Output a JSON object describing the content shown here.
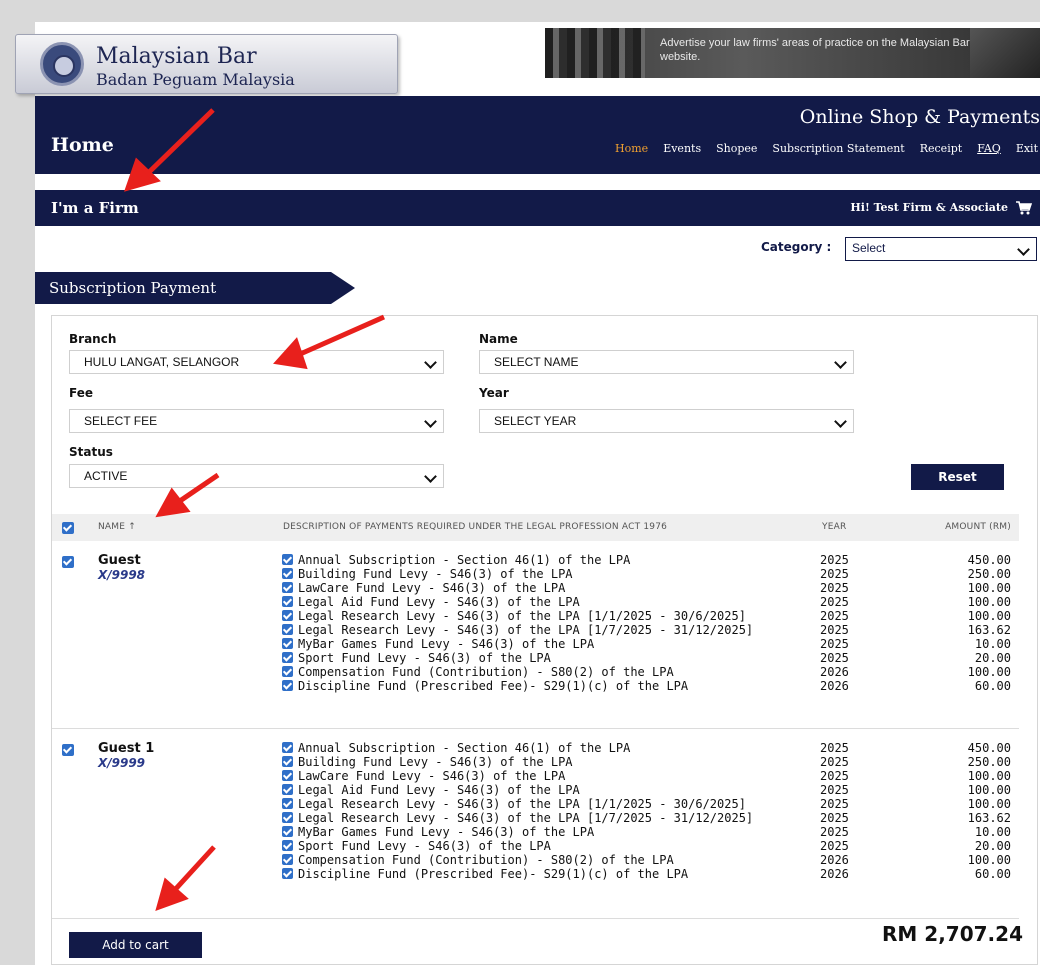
{
  "header": {
    "logo_title": "Malaysian Bar",
    "logo_subtitle": "Badan Peguam Malaysia",
    "ad_text": "Advertise your law firms' areas of practice on the Malaysian Bar website.",
    "shop_title": "Online Shop & Payments",
    "page_title": "Home",
    "nav": [
      {
        "label": "Home",
        "active": true
      },
      {
        "label": "Events"
      },
      {
        "label": "Shopee"
      },
      {
        "label": "Subscription Statement"
      },
      {
        "label": "Receipt"
      },
      {
        "label": "FAQ",
        "underline": true
      },
      {
        "label": "Exit"
      }
    ]
  },
  "firm_bar": {
    "title": "I'm a Firm",
    "greeting": "Hi! Test Firm & Associate",
    "icon": "cart-icon"
  },
  "category": {
    "label": "Category :",
    "value": "Select"
  },
  "section": {
    "title": "Subscription Payment"
  },
  "filters": {
    "branch": {
      "label": "Branch",
      "value": "HULU LANGAT, SELANGOR"
    },
    "name": {
      "label": "Name",
      "value": "SELECT NAME"
    },
    "fee": {
      "label": "Fee",
      "value": "SELECT FEE"
    },
    "year": {
      "label": "Year",
      "value": "SELECT YEAR"
    },
    "status": {
      "label": "Status",
      "value": "ACTIVE"
    },
    "reset_label": "Reset"
  },
  "table": {
    "columns": {
      "name": "NAME ↑",
      "description": "DESCRIPTION OF PAYMENTS REQUIRED UNDER THE LEGAL PROFESSION ACT 1976",
      "year": "YEAR",
      "amount": "AMOUNT (RM)"
    },
    "groups": [
      {
        "name": "Guest",
        "code": "X/9998",
        "items": [
          {
            "desc": "Annual Subscription - Section 46(1) of the LPA",
            "year": "2025",
            "amount": "450.00"
          },
          {
            "desc": "Building Fund Levy - S46(3) of the LPA",
            "year": "2025",
            "amount": "250.00"
          },
          {
            "desc": "LawCare Fund Levy - S46(3) of the LPA",
            "year": "2025",
            "amount": "100.00"
          },
          {
            "desc": "Legal Aid Fund Levy - S46(3) of the LPA",
            "year": "2025",
            "amount": "100.00"
          },
          {
            "desc": "Legal Research Levy - S46(3) of the LPA [1/1/2025 - 30/6/2025]",
            "year": "2025",
            "amount": "100.00"
          },
          {
            "desc": "Legal Research Levy - S46(3) of the LPA [1/7/2025 - 31/12/2025]",
            "year": "2025",
            "amount": "163.62"
          },
          {
            "desc": "MyBar Games Fund Levy - S46(3) of the LPA",
            "year": "2025",
            "amount": "10.00"
          },
          {
            "desc": "Sport Fund Levy - S46(3) of the LPA",
            "year": "2025",
            "amount": "20.00"
          },
          {
            "desc": "Compensation Fund (Contribution) - S80(2) of the LPA",
            "year": "2026",
            "amount": "100.00"
          },
          {
            "desc": "Discipline Fund (Prescribed Fee)- S29(1)(c) of the LPA",
            "year": "2026",
            "amount": "60.00"
          }
        ]
      },
      {
        "name": "Guest 1",
        "code": "X/9999",
        "items": [
          {
            "desc": "Annual Subscription - Section 46(1) of the LPA",
            "year": "2025",
            "amount": "450.00"
          },
          {
            "desc": "Building Fund Levy - S46(3) of the LPA",
            "year": "2025",
            "amount": "250.00"
          },
          {
            "desc": "LawCare Fund Levy - S46(3) of the LPA",
            "year": "2025",
            "amount": "100.00"
          },
          {
            "desc": "Legal Aid Fund Levy - S46(3) of the LPA",
            "year": "2025",
            "amount": "100.00"
          },
          {
            "desc": "Legal Research Levy - S46(3) of the LPA [1/1/2025 - 30/6/2025]",
            "year": "2025",
            "amount": "100.00"
          },
          {
            "desc": "Legal Research Levy - S46(3) of the LPA [1/7/2025 - 31/12/2025]",
            "year": "2025",
            "amount": "163.62"
          },
          {
            "desc": "MyBar Games Fund Levy - S46(3) of the LPA",
            "year": "2025",
            "amount": "10.00"
          },
          {
            "desc": "Sport Fund Levy - S46(3) of the LPA",
            "year": "2025",
            "amount": "20.00"
          },
          {
            "desc": "Compensation Fund (Contribution) - S80(2) of the LPA",
            "year": "2026",
            "amount": "100.00"
          },
          {
            "desc": "Discipline Fund (Prescribed Fee)- S29(1)(c) of the LPA",
            "year": "2026",
            "amount": "60.00"
          }
        ]
      }
    ]
  },
  "footer": {
    "add_to_cart_label": "Add to cart",
    "total": "RM 2,707.24"
  },
  "colors": {
    "navy": "#121a48",
    "accent": "#f0a030",
    "checkbox": "#2f6fc8",
    "annotation": "#e8201c"
  }
}
